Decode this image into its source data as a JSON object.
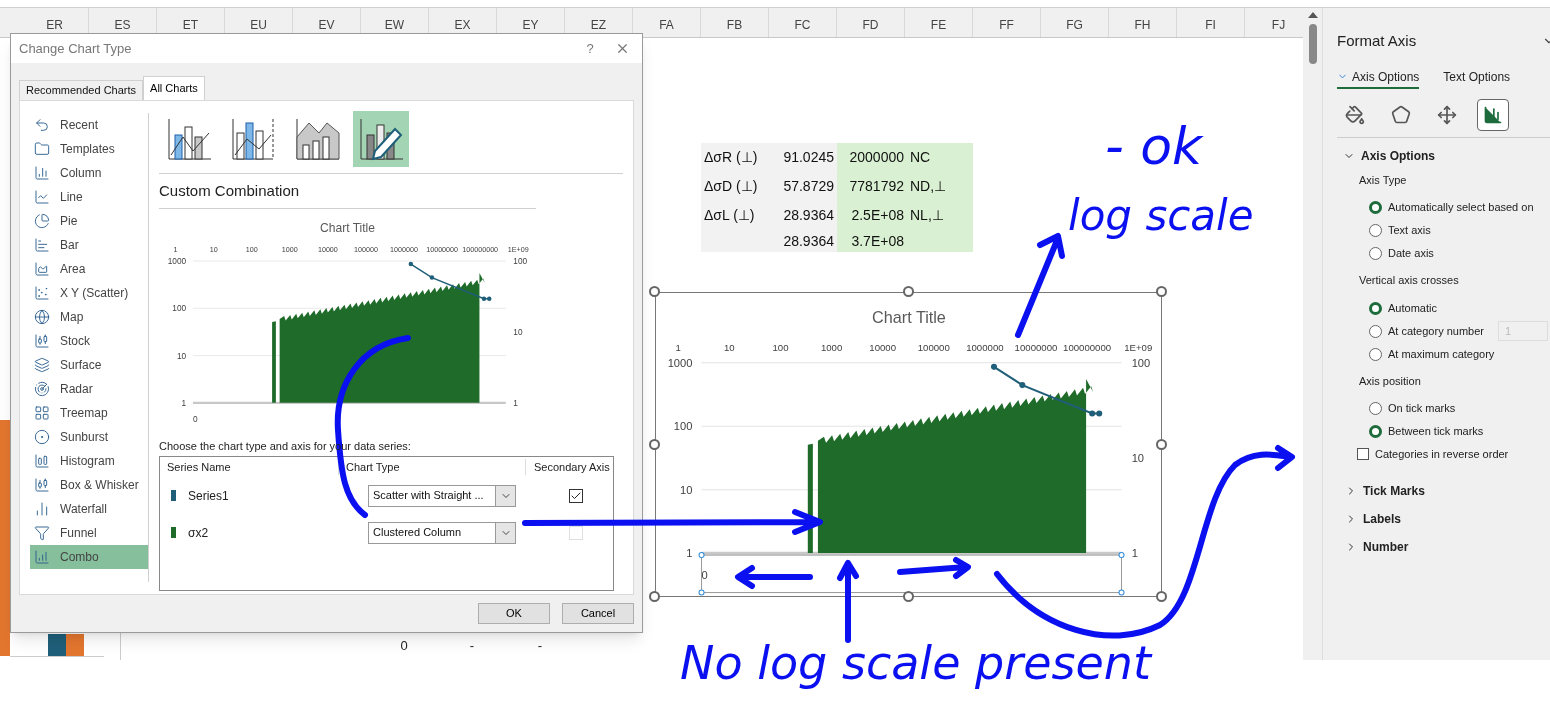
{
  "sheet": {
    "columns": [
      "ER",
      "ES",
      "ET",
      "EU",
      "EV",
      "EW",
      "EX",
      "EY",
      "EZ",
      "FA",
      "FB",
      "FC",
      "FD",
      "FE",
      "FF",
      "FG",
      "FH",
      "FI",
      "FJ"
    ],
    "table": [
      {
        "label": "ΔσR (⊥)",
        "value": "91.0245",
        "number": "2000000",
        "note": "NC"
      },
      {
        "label": "ΔσD (⊥)",
        "value": "57.8729",
        "number": "7781792",
        "note": "ND,⊥"
      },
      {
        "label": "ΔσL (⊥)",
        "value": "28.9364",
        "number": "2.5E+08",
        "note": "NL,⊥"
      },
      {
        "value": "28.9364",
        "number": "3.7E+08"
      }
    ],
    "bottom_row": [
      "0",
      "-",
      "-"
    ]
  },
  "chart": {
    "title": "Chart Title",
    "top_axis": [
      "1",
      "10",
      "100",
      "1000",
      "10000",
      "100000",
      "1000000",
      "10000000",
      "100000000",
      "1E+09"
    ],
    "left_axis": [
      "1000",
      "100",
      "10",
      "1"
    ],
    "right_axis": [
      "100",
      "10",
      "1"
    ],
    "bottom_label": "0",
    "axis_selected": true
  },
  "dialog": {
    "title": "Change Chart Type",
    "help": "?",
    "tabs": [
      {
        "label": "Recommended Charts",
        "selected": false
      },
      {
        "label": "All Charts",
        "selected": true
      }
    ],
    "categories": [
      {
        "label": "Recent",
        "selected": false
      },
      {
        "label": "Templates",
        "selected": false
      },
      {
        "label": "Column",
        "selected": false
      },
      {
        "label": "Line",
        "selected": false
      },
      {
        "label": "Pie",
        "selected": false
      },
      {
        "label": "Bar",
        "selected": false
      },
      {
        "label": "Area",
        "selected": false
      },
      {
        "label": "X Y (Scatter)",
        "selected": false
      },
      {
        "label": "Map",
        "selected": false
      },
      {
        "label": "Stock",
        "selected": false
      },
      {
        "label": "Surface",
        "selected": false
      },
      {
        "label": "Radar",
        "selected": false
      },
      {
        "label": "Treemap",
        "selected": false
      },
      {
        "label": "Sunburst",
        "selected": false
      },
      {
        "label": "Histogram",
        "selected": false
      },
      {
        "label": "Box & Whisker",
        "selected": false
      },
      {
        "label": "Waterfall",
        "selected": false
      },
      {
        "label": "Funnel",
        "selected": false
      },
      {
        "label": "Combo",
        "selected": true
      }
    ],
    "subtypes": [
      {
        "selected": false
      },
      {
        "selected": false
      },
      {
        "selected": false
      },
      {
        "selected": true
      }
    ],
    "subtype_title": "Custom Combination",
    "preview": {
      "title": "Chart Title",
      "top_axis": [
        "1",
        "10",
        "100",
        "1000",
        "10000",
        "100000",
        "1000000",
        "10000000",
        "100000000",
        "1E+09"
      ],
      "left_axis": [
        "1000",
        "100",
        "10",
        "1"
      ],
      "right_axis": [
        "100",
        "10",
        "1"
      ],
      "bottom_label": "0"
    },
    "series_prompt": "Choose the chart type and axis for your data series:",
    "series_columns": [
      "Series Name",
      "Chart Type",
      "Secondary Axis"
    ],
    "series": [
      {
        "name": "Series1",
        "color": "#1f5f7a",
        "chart_type": "Scatter with Straight ...",
        "checked": true,
        "disabled": false
      },
      {
        "name": "σx2",
        "color": "#1e6b2a",
        "chart_type": "Clustered Column",
        "checked": false,
        "disabled": true
      }
    ],
    "buttons": [
      "OK",
      "Cancel"
    ]
  },
  "format_pane": {
    "title": "Format Axis",
    "tabs": [
      {
        "label": "Axis Options",
        "selected": true
      },
      {
        "label": "Text Options",
        "selected": false
      }
    ],
    "icons": [
      {
        "selected": false
      },
      {
        "selected": false
      },
      {
        "selected": false
      },
      {
        "selected": true
      }
    ],
    "section": {
      "title": "Axis Options",
      "expanded": true
    },
    "groups": [
      {
        "label": "Axis Type",
        "options": [
          {
            "label": "Automatically select based on",
            "selected": true
          },
          {
            "label": "Text axis",
            "selected": false
          },
          {
            "label": "Date axis",
            "selected": false
          }
        ]
      },
      {
        "label": "Vertical axis crosses",
        "options": [
          {
            "label": "Automatic",
            "selected": true
          },
          {
            "label": "At category number",
            "selected": false,
            "value": "1",
            "disabled": true
          },
          {
            "label": "At maximum category",
            "selected": false
          }
        ]
      },
      {
        "label": "Axis position",
        "options": [
          {
            "label": "On tick marks",
            "selected": false
          },
          {
            "label": "Between tick marks",
            "selected": true
          }
        ]
      }
    ],
    "reverse_order": {
      "label": "Categories in reverse order",
      "checked": false
    },
    "collapsed_sections": [
      {
        "title": "Tick Marks",
        "expanded": false
      },
      {
        "title": "Labels",
        "expanded": false
      },
      {
        "title": "Number",
        "expanded": false
      }
    ]
  },
  "annotations": [
    "- ok",
    "log scale",
    "No log scale present"
  ]
}
